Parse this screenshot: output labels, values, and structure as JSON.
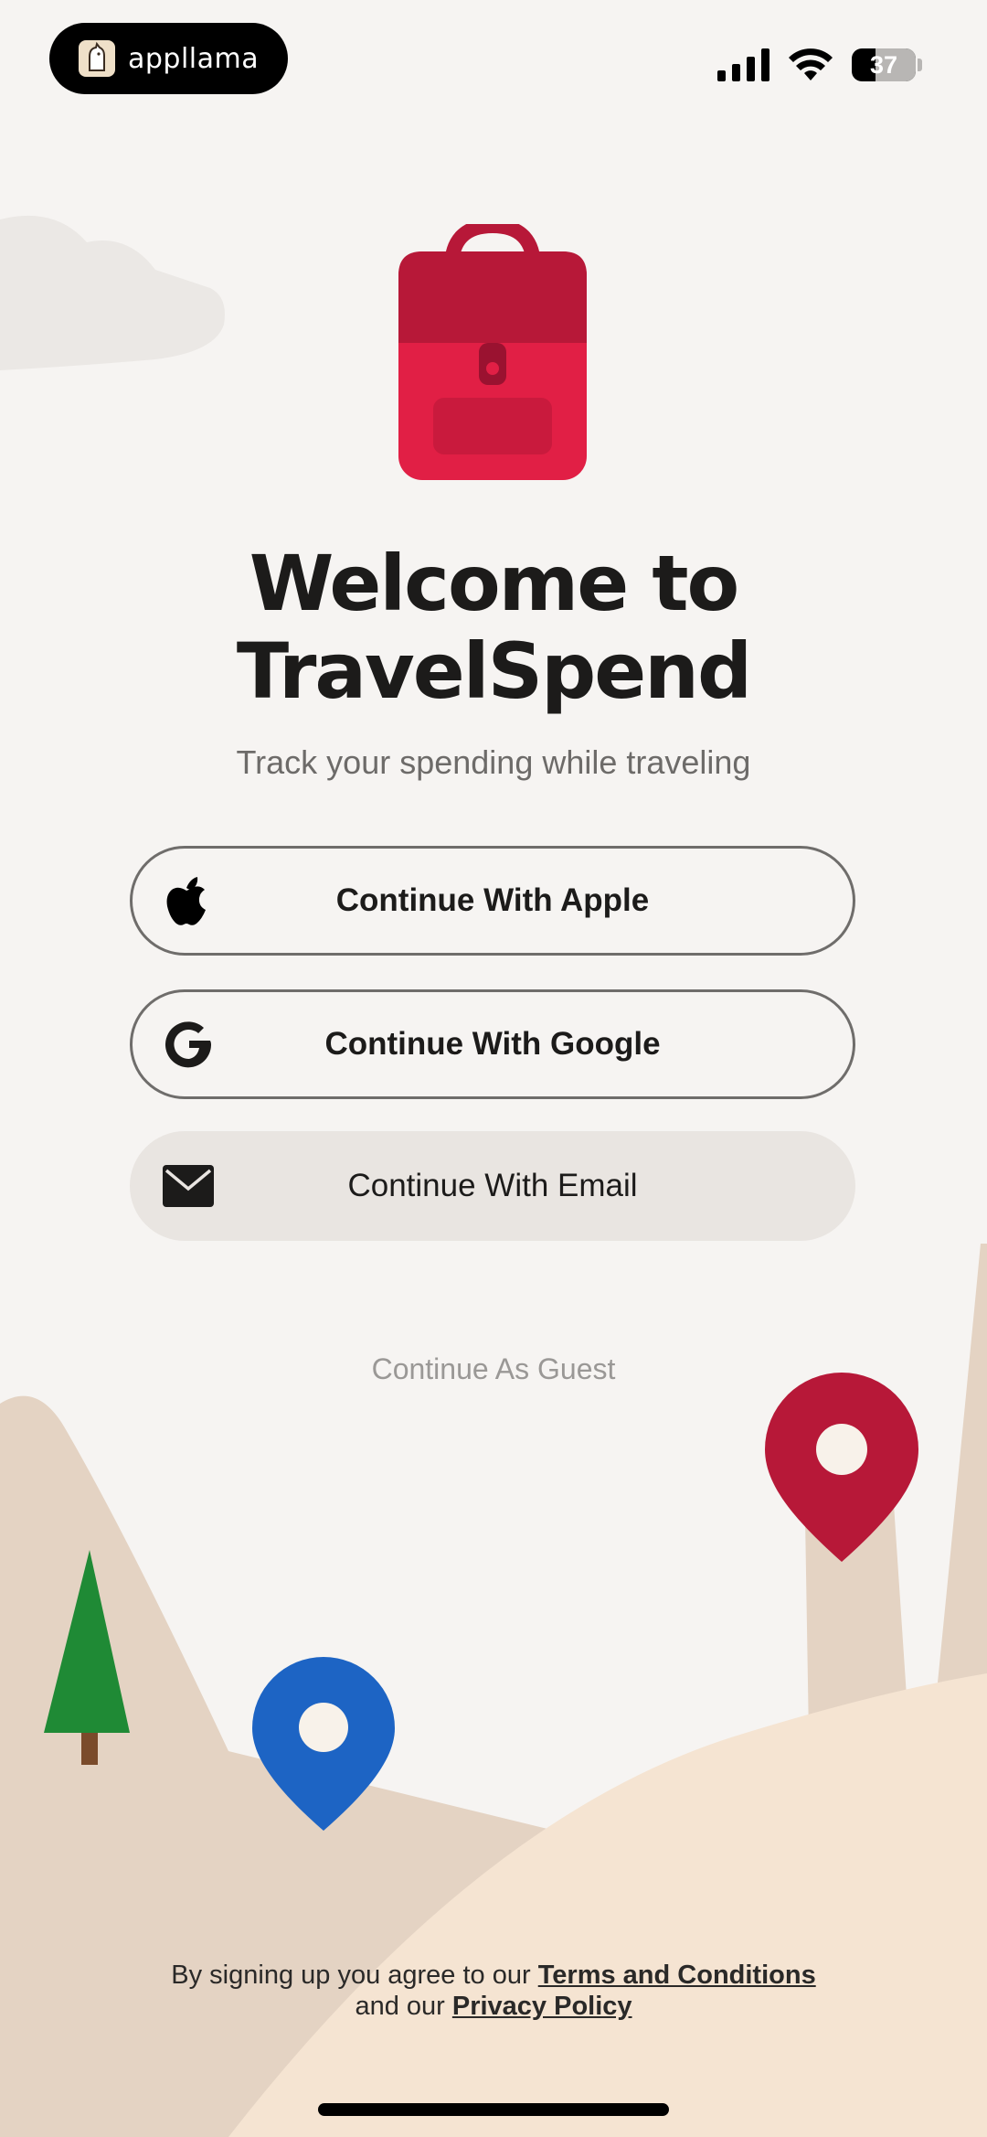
{
  "status_bar": {
    "badge_label": "appllama",
    "battery_level": "37",
    "battery_percent": 37
  },
  "welcome": {
    "title_line1": "Welcome to",
    "title_line2": "TravelSpend",
    "subtitle": "Track your spending while traveling"
  },
  "auth": {
    "apple_label": "Continue With Apple",
    "google_label": "Continue With Google",
    "email_label": "Continue With Email",
    "guest_label": "Continue As Guest"
  },
  "legal": {
    "prefix": "By signing up you agree to our",
    "terms_link": "Terms and Conditions",
    "middle": "and our",
    "privacy_link": "Privacy Policy"
  },
  "colors": {
    "background": "#f6f4f2",
    "backpack": "#e11f45",
    "pin_red": "#b71838",
    "pin_blue": "#1d64c4",
    "tree": "#1f8a35",
    "hill": "#e4d3c3",
    "hill_light": "#f5e4d2"
  },
  "icons": [
    "apple-icon",
    "google-icon",
    "mail-icon",
    "backpack-icon",
    "location-pin-icon",
    "tree-icon",
    "cloud-icon"
  ]
}
